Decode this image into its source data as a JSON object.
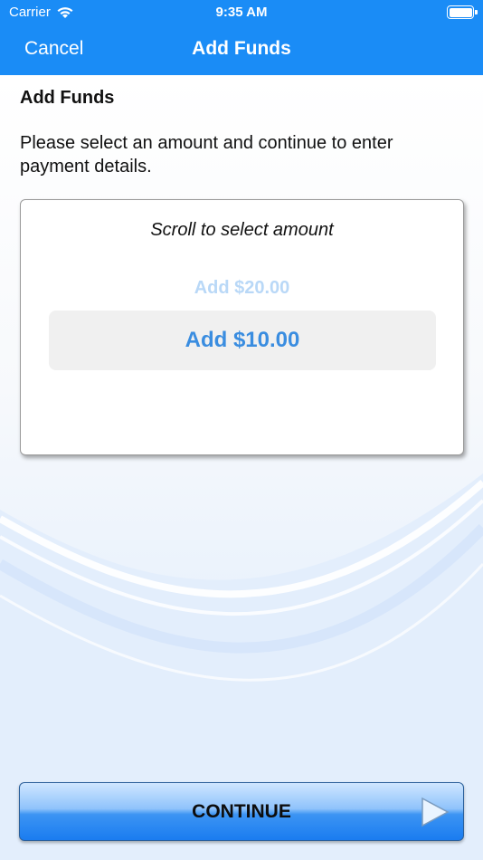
{
  "status_bar": {
    "carrier": "Carrier",
    "time": "9:35 AM"
  },
  "nav": {
    "cancel_label": "Cancel",
    "title": "Add Funds"
  },
  "content": {
    "heading": "Add Funds",
    "intro": "Please select an amount and continue to enter payment details.",
    "picker": {
      "hint": "Scroll to select amount",
      "options": [
        "Add $20.00",
        "Add $10.00"
      ],
      "selected": "Add $10.00"
    }
  },
  "footer": {
    "continue_label": "CONTINUE"
  },
  "colors": {
    "nav_background": "#1a8cf6",
    "selected_amount": "#3a8de0",
    "faded_amount": "#b9d8f7"
  },
  "icons": [
    "wifi-icon",
    "battery-icon",
    "play-icon"
  ]
}
